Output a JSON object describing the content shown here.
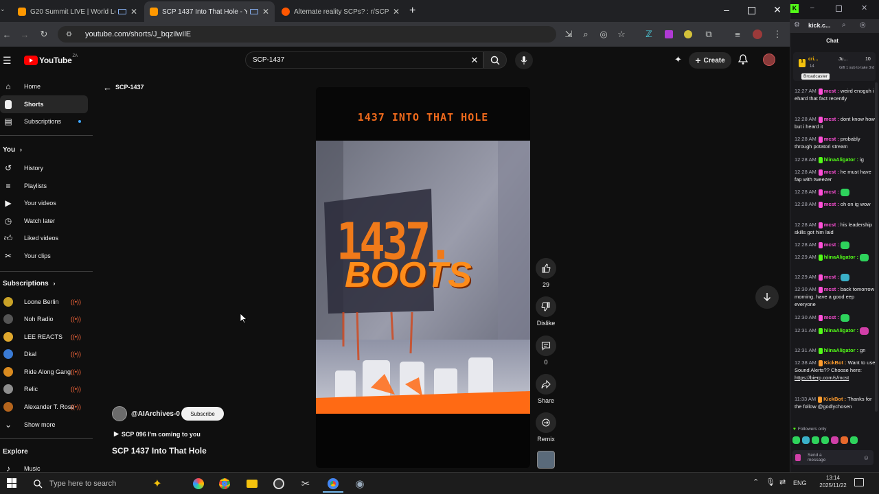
{
  "browser": {
    "tabs": [
      {
        "title": "G20 Summit LIVE | World Le",
        "favicon_color": "#ff9800"
      },
      {
        "title": "SCP 1437 Into That Hole - Y",
        "favicon_color": "#ff9800"
      },
      {
        "title": "Alternate reality SCPs? : r/SCP",
        "favicon_color": "#ff5700"
      }
    ],
    "url": "youtube.com/shorts/J_bqzilwIlE"
  },
  "youtube": {
    "logo": "YouTube",
    "logo_region": "ZA",
    "search_value": "SCP-1437",
    "create_label": "Create",
    "back_title": "SCP-1437",
    "nav_main": [
      {
        "label": "Home",
        "icon": "home-icon"
      },
      {
        "label": "Shorts",
        "icon": "shorts-icon"
      },
      {
        "label": "Subscriptions",
        "icon": "subscriptions-icon"
      }
    ],
    "you_heading": "You",
    "nav_you": [
      {
        "label": "History",
        "icon": "history-icon"
      },
      {
        "label": "Playlists",
        "icon": "playlists-icon"
      },
      {
        "label": "Your videos",
        "icon": "your-videos-icon"
      },
      {
        "label": "Watch later",
        "icon": "watch-later-icon"
      },
      {
        "label": "Liked videos",
        "icon": "liked-videos-icon"
      },
      {
        "label": "Your clips",
        "icon": "scissors-icon"
      }
    ],
    "subscriptions_heading": "Subscriptions",
    "subscriptions": [
      {
        "label": "Loone Berlin",
        "color": "#c9a227"
      },
      {
        "label": "Noh Radio",
        "color": "#555555"
      },
      {
        "label": "LEE REACTS",
        "color": "#e0a82e"
      },
      {
        "label": "Dkal",
        "color": "#3a7bd5"
      },
      {
        "label": "Ride Along Gang",
        "color": "#d98a1f"
      },
      {
        "label": "Relic",
        "color": "#8e8e8e"
      },
      {
        "label": "Alexander T. Rose",
        "color": "#b5651d"
      }
    ],
    "show_more": "Show more",
    "explore_heading": "Explore",
    "explore_items": [
      {
        "label": "Music"
      }
    ],
    "video": {
      "top_caption": "1437 INTO THAT HOLE",
      "big_number": "1437.",
      "big_word": "BOOTS"
    },
    "channel": "@AIArchives-0",
    "subscribe_label": "Subscribe",
    "playlist_line": "SCP 096 I'm coming to you",
    "video_title": "SCP 1437 Into That Hole",
    "actions": {
      "like_count": "29",
      "dislike_label": "Dislike",
      "comment_count": "0",
      "share_label": "Share",
      "remix_label": "Remix"
    }
  },
  "kick": {
    "tab_title": "kick.c...",
    "chat_header": "Chat",
    "pinned_user": "cri...",
    "pinned_badge": "Ju...",
    "pinned_count": "10",
    "pinned_num": "14",
    "pinned_note": "Gift 1 sub to take 3rd",
    "broadcaster_tooltip": "Broadcaster",
    "messages": [
      {
        "time": "12:27 AM",
        "user": "mcst",
        "user_color": "#ff4fd8",
        "text": "weird enoguh i ehard that fact recently"
      },
      {
        "time": "12:28 AM",
        "user": "mcst",
        "user_color": "#ff4fd8",
        "text": "dont know how but i heard it"
      },
      {
        "time": "12:28 AM",
        "user": "mcst",
        "user_color": "#ff4fd8",
        "text": "probably through potatori stream"
      },
      {
        "time": "12:28 AM",
        "user": "hlinaAligator",
        "user_color": "#53fc18",
        "text": "ig"
      },
      {
        "time": "12:28 AM",
        "user": "mcst",
        "user_color": "#ff4fd8",
        "text": "he must have fap with tweezer"
      },
      {
        "time": "12:28 AM",
        "user": "mcst",
        "user_color": "#ff4fd8",
        "text": "",
        "emote": true
      },
      {
        "time": "12:28 AM",
        "user": "mcst",
        "user_color": "#ff4fd8",
        "text": "oh on ig wow"
      },
      {
        "time": "12:28 AM",
        "user": "mcst",
        "user_color": "#ff4fd8",
        "text": "his leadership skills got him laid"
      },
      {
        "time": "12:28 AM",
        "user": "mcst",
        "user_color": "#ff4fd8",
        "text": "",
        "emote": true
      },
      {
        "time": "12:29 AM",
        "user": "hlinaAligator",
        "user_color": "#53fc18",
        "text": "",
        "emote": true
      },
      {
        "time": "12:29 AM",
        "user": "mcst",
        "user_color": "#ff4fd8",
        "text": "",
        "emote": true
      },
      {
        "time": "12:30 AM",
        "user": "mcst",
        "user_color": "#ff4fd8",
        "text": "back tomorrow morning. have a good eep everyone"
      },
      {
        "time": "12:30 AM",
        "user": "mcst",
        "user_color": "#ff4fd8",
        "text": "",
        "emote": true
      },
      {
        "time": "12:31 AM",
        "user": "hlinaAligator",
        "user_color": "#53fc18",
        "text": "",
        "emote": true
      },
      {
        "time": "12:31 AM",
        "user": "hlinaAligator",
        "user_color": "#53fc18",
        "text": "gn"
      },
      {
        "time": "12:38 AM",
        "user": "KickBot",
        "user_color": "#ff9d2f",
        "text": "Want to use Sound Alerts?? Choose here:",
        "link": "https://bierp.com/s/mcst"
      },
      {
        "time": "11:33 AM",
        "user": "KickBot",
        "user_color": "#ff9d2f",
        "text": "Thanks for the follow @godlychosen"
      }
    ],
    "followers_only": "Followers only",
    "input_placeholder": "Send a message"
  },
  "taskbar": {
    "search_placeholder": "Type here to search",
    "language": "ENG",
    "time": "13:14",
    "date": "2025/11/22"
  }
}
